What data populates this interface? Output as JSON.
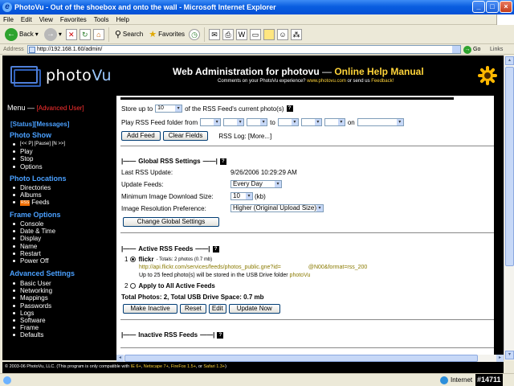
{
  "window": {
    "title": "PhotoVu - Out of the shoebox and onto the wall - Microsoft Internet Explorer",
    "controls": [
      "_",
      "□",
      "×"
    ]
  },
  "menubar": {
    "items": [
      "File",
      "Edit",
      "View",
      "Favorites",
      "Tools",
      "Help"
    ]
  },
  "toolbar": {
    "back": "Back",
    "search": "Search",
    "favorites": "Favorites"
  },
  "address": {
    "label": "Address",
    "url": "http://192.168.1.60/admin/",
    "go": "Go",
    "links": "Links"
  },
  "header": {
    "logo_a": "photo",
    "logo_b": "Vu",
    "title": "Web Administration for photovu",
    "title_sep": " — ",
    "help": "Online Help Manual",
    "sub_a": "Comments on your PhotoVu experience? ",
    "sub_site": "www.photovu.com",
    "sub_b": " or send us ",
    "sub_feedback": "Feedback!"
  },
  "sidebar": {
    "menu_label": "Menu — ",
    "menu_mode": "[Advanced User]",
    "quick_status": "[Status]",
    "quick_messages": "[Messages]",
    "sections": [
      {
        "title": "Photo Show",
        "items": [
          "[<< P] [Pause] [N >>]",
          "Play",
          "Stop",
          "Options"
        ]
      },
      {
        "title": "Photo Locations",
        "items": [
          "Directories",
          "Albums",
          "Feeds"
        ]
      },
      {
        "title": "Frame Options",
        "items": [
          "Console",
          "Date & Time",
          "Display",
          "Name",
          "Restart",
          "Power Off"
        ]
      },
      {
        "title": "Advanced Settings",
        "items": [
          "Basic User",
          "Networking",
          "Mappings",
          "Passwords",
          "Logs",
          "Software",
          "Frame",
          "Defaults"
        ]
      }
    ],
    "rss_badge": "RSS"
  },
  "content": {
    "store_a": "Store up to",
    "store_value": "10",
    "store_b": "of the RSS Feed's current photo(s)",
    "play_label": "Play RSS Feed folder from",
    "to_label": "to",
    "on_label": "on",
    "add_feed": "Add Feed",
    "clear_fields": "Clear Fields",
    "rss_log": "RSS Log: [More...]",
    "global_title": "Global RSS Settings",
    "last_update_label": "Last RSS Update:",
    "last_update_value": "9/26/2006 10:29:29 AM",
    "update_feeds_label": "Update Feeds:",
    "update_feeds_value": "Every Day",
    "min_dl_label": "Minimum Image Download Size:",
    "min_dl_value": "10",
    "min_dl_unit": "(kb)",
    "res_pref_label": "Image Resolution Preference:",
    "res_pref_value": "Higher (Original Upload Size)",
    "change_global": "Change Global Settings",
    "active_title": "Active RSS Feeds",
    "feed1_num": "1",
    "feed1_name": "flickr",
    "feed1_totals": " - Totals: 2 photos (0.7 mb)",
    "feed1_url_a": "http://api.flickr.com/services/feeds/photos_public.gne?id=",
    "feed1_url_b": "@N00&format=rss_200",
    "feed1_desc": "Up to 25 feed photo(s) will be stored in the USB Drive folder ",
    "feed1_folder": "photoVu",
    "feed2_num": "2",
    "feed2_label": "Apply to All Active Feeds",
    "totals": "Total Photos: 2, Total USB Drive Space: 0.7 mb",
    "make_inactive": "Make Inactive",
    "reset": "Reset",
    "edit": "Edit",
    "update_now": "Update Now",
    "inactive_title": "Inactive RSS Feeds",
    "bracket_l": "|——",
    "bracket_r": "——|",
    "help_mark": "?"
  },
  "footer": {
    "a": "© 2003-06 PhotoVu, LLC.  (This program is only compatible with ",
    "ie": "IE 6+",
    "s1": ", ",
    "ns": "Netscape 7+",
    "ff": "FireFox 1.5+",
    "s2": ", or ",
    "sf": "Safari 1.3+",
    "b": ")"
  },
  "status": {
    "zone": "Internet",
    "tag": "#14711"
  },
  "colors": {
    "accent_blue": "#4aa0ff",
    "header_yellow": "#ffd43a",
    "advanced_red": "#ff3030"
  }
}
